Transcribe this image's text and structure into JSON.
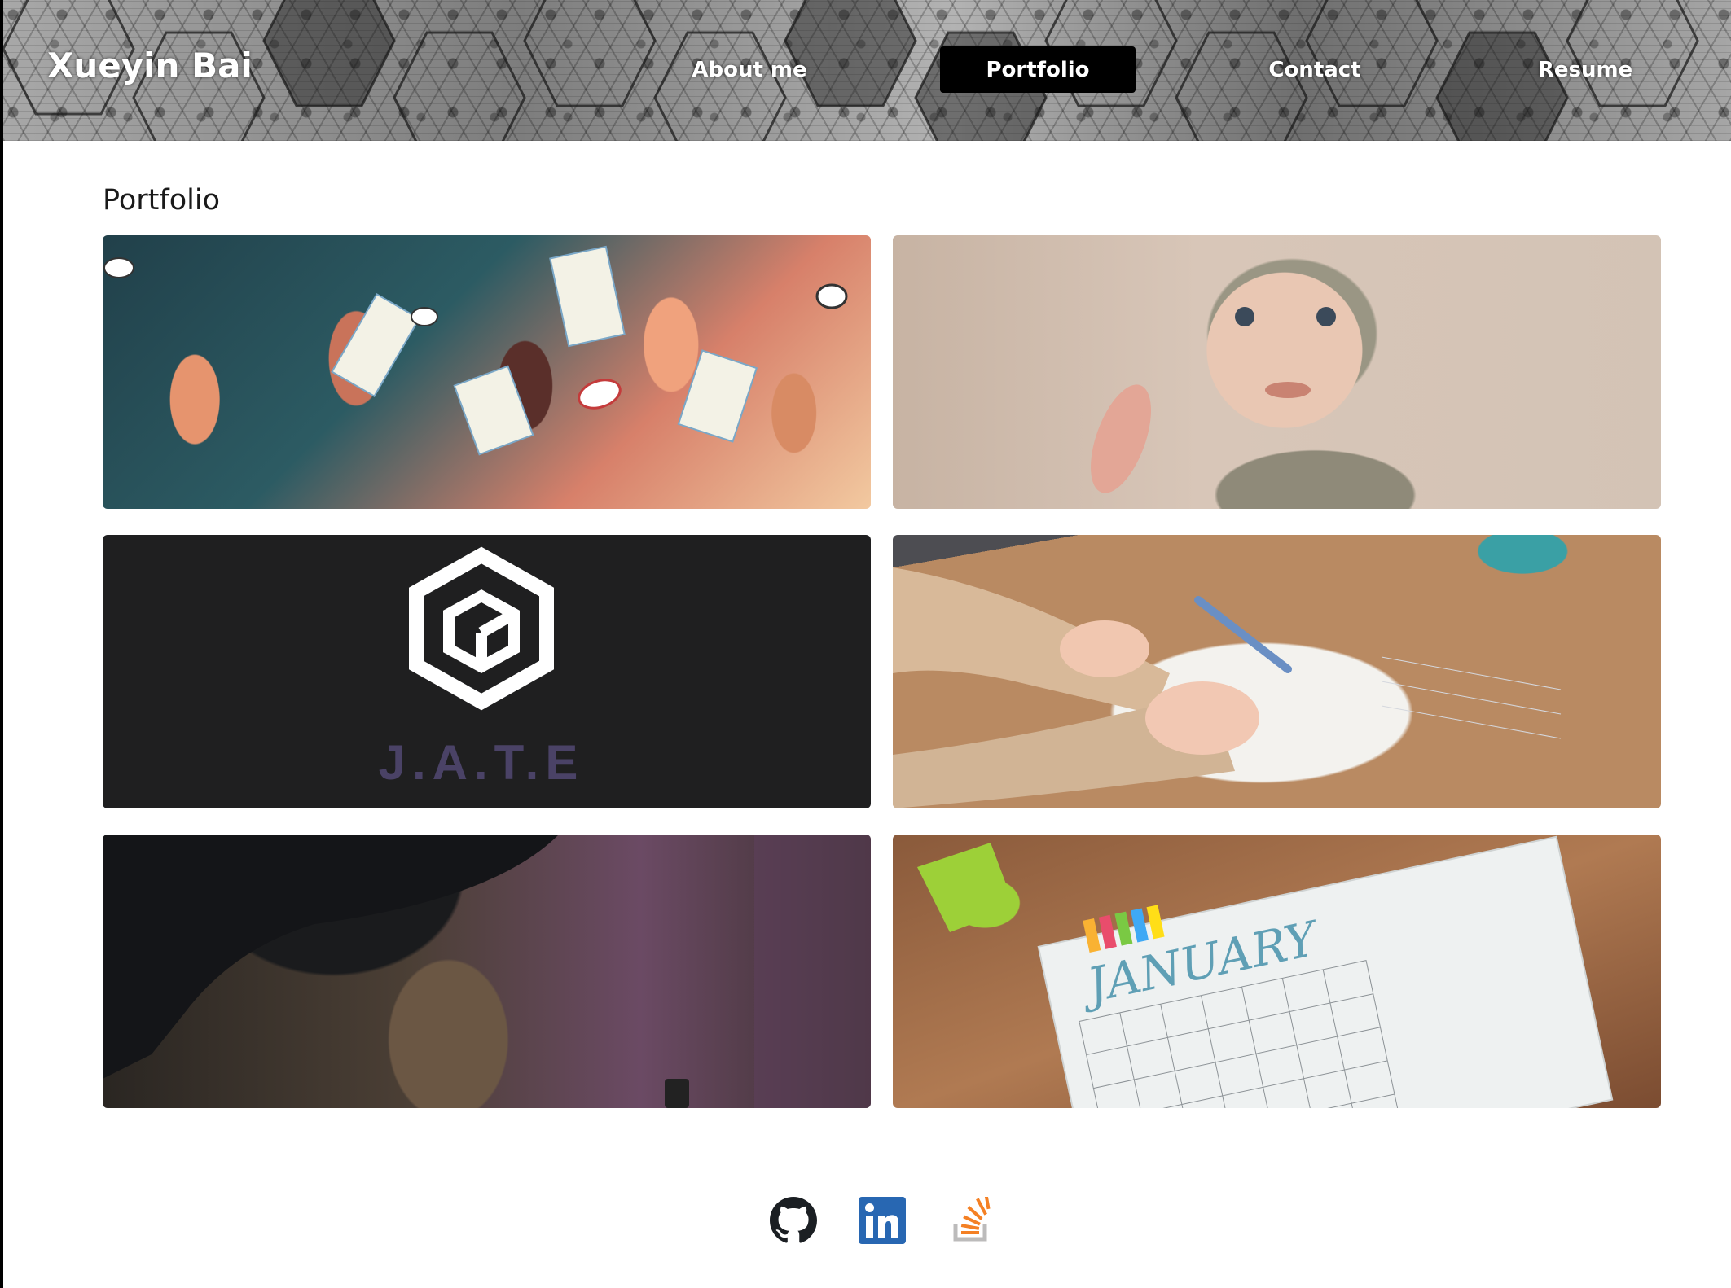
{
  "header": {
    "brand": "Xueyin Bai",
    "nav": [
      {
        "label": "About me",
        "active": false
      },
      {
        "label": "Portfolio",
        "active": true
      },
      {
        "label": "Contact",
        "active": false
      },
      {
        "label": "Resume",
        "active": false
      }
    ]
  },
  "main": {
    "title": "Portfolio",
    "projects": [
      {
        "image": "voting-hands-illustration"
      },
      {
        "image": "baby-photo"
      },
      {
        "image": "jate-logo",
        "text": "J.A.T.E"
      },
      {
        "image": "writing-in-notebook-photo"
      },
      {
        "image": "umbrella-person-photo"
      },
      {
        "image": "january-calendar-journal-photo",
        "text": "JANUARY"
      }
    ]
  },
  "footer": {
    "icons": [
      "github-icon",
      "linkedin-icon",
      "stackoverflow-icon"
    ]
  },
  "colors": {
    "nav_active_bg": "#000000",
    "linkedin_blue": "#2867b2",
    "stackoverflow_orange": "#f48024",
    "jate_purple": "#4a4266"
  }
}
